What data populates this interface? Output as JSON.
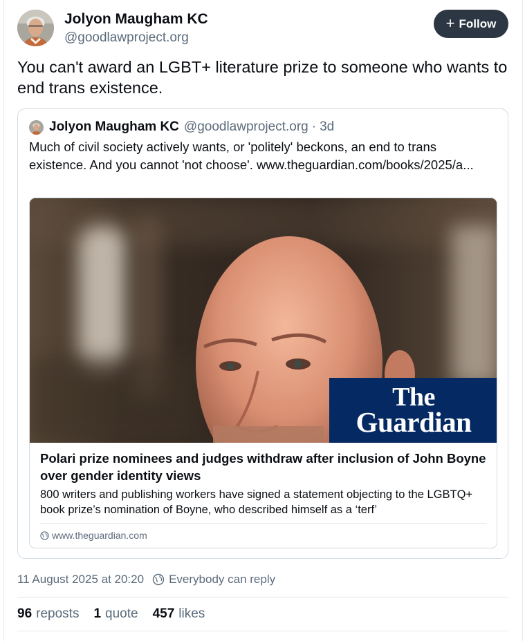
{
  "post": {
    "author": {
      "name": "Jolyon Maugham KC",
      "handle": "@goodlawproject.org"
    },
    "follow_button": {
      "icon": "plus-icon",
      "label": "Follow"
    },
    "text": "You can't award an LGBT+ literature prize to someone who wants to end trans existence.",
    "quote": {
      "author_name": "Jolyon Maugham KC",
      "author_handle": "@goodlawproject.org",
      "separator": "·",
      "time": "3d",
      "text": "Much of civil society actively wants, or 'politely' beckons, an end to trans existence. And you cannot 'not choose'. www.theguardian.com/books/2025/a...",
      "link_card": {
        "logo_line1": "The",
        "logo_line2": "Guardian",
        "logo_color": "#052962",
        "title": "Polari prize nominees and judges withdraw after inclusion of John Boyne over gender identity views",
        "description": "800 writers and publishing workers have signed a statement objecting to the LGBTQ+ book prize’s nomination of Boyne, who described himself as a ‘terf’",
        "domain": "www.theguardian.com",
        "domain_icon": "globe-icon"
      }
    },
    "timestamp": "11 August 2025 at 20:20",
    "reply_setting": {
      "icon": "globe-reply-icon",
      "label": "Everybody can reply"
    },
    "stats": {
      "reposts": {
        "count": "96",
        "label": "reposts"
      },
      "quotes": {
        "count": "1",
        "label": "quote"
      },
      "likes": {
        "count": "457",
        "label": "likes"
      }
    }
  },
  "colors": {
    "text_primary": "#0b0f14",
    "text_secondary": "#5b6b7b",
    "follow_button_bg": "#2c3743",
    "border": "#d4dbe2"
  }
}
